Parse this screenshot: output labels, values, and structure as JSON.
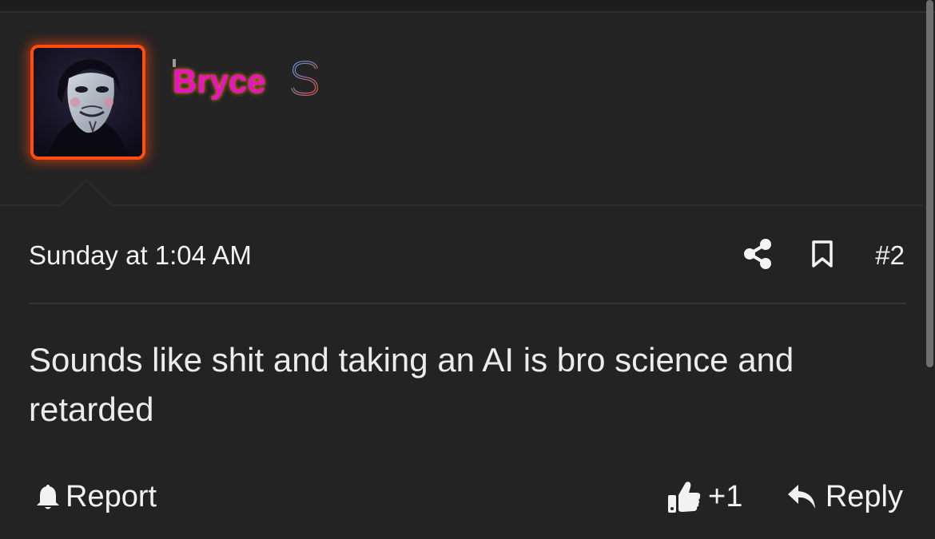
{
  "author": {
    "username": "Bryce",
    "avatar_icon": "anonymous-mask-avatar",
    "badge_icon": "dollar-sign-icon",
    "username_color": "#ea12c4",
    "avatar_border_color": "#ff4d12"
  },
  "post": {
    "date": "Sunday at 1:04 AM",
    "number": "#2",
    "body": "Sounds like shit and taking an AI is bro science and retarded"
  },
  "actions": {
    "share_icon": "share-icon",
    "bookmark_icon": "bookmark-icon",
    "report_label": "Report",
    "like_count": "+1",
    "reply_label": "Reply"
  }
}
